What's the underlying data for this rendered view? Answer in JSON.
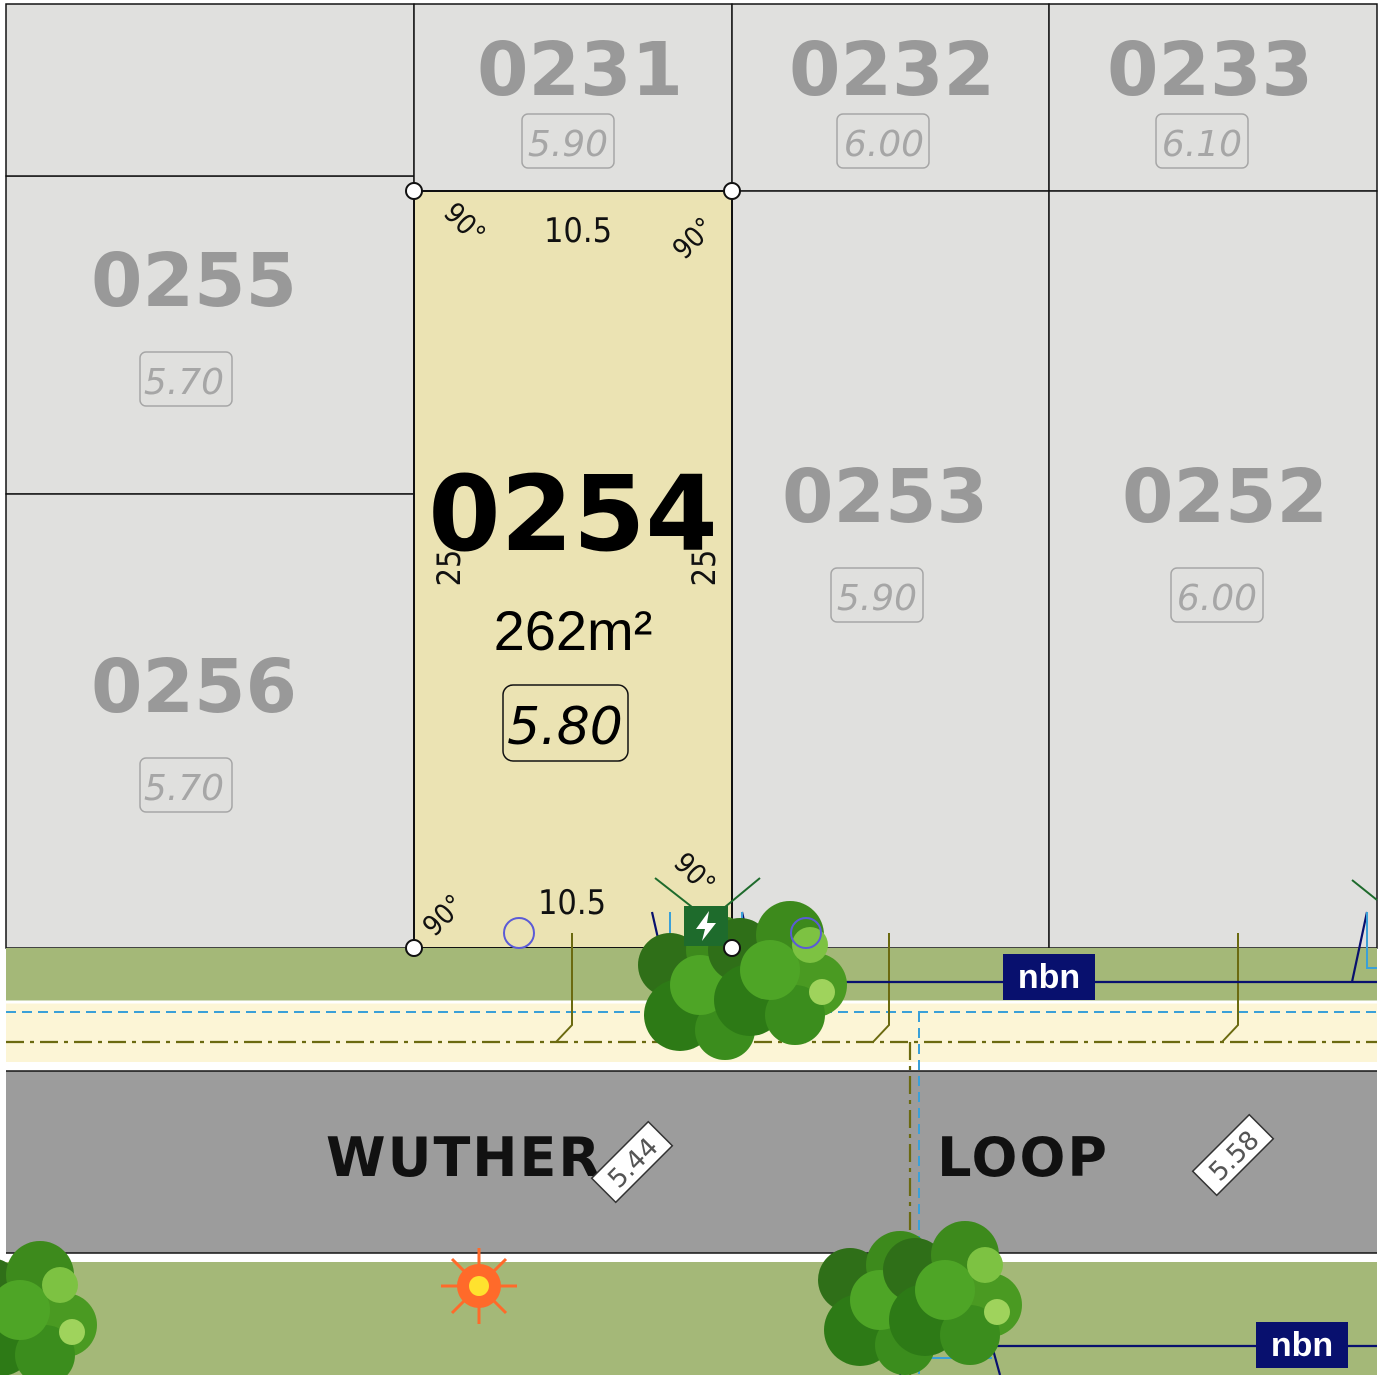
{
  "selected_lot": {
    "number": "0254",
    "area": "262m²",
    "level": "5.80",
    "frontage": "10.5",
    "depth": "25",
    "angle": "90°"
  },
  "lots": [
    {
      "number": "0231",
      "level": "5.90"
    },
    {
      "number": "0232",
      "level": "6.00"
    },
    {
      "number": "0233",
      "level": "6.10"
    },
    {
      "number": "0255",
      "level": "5.70"
    },
    {
      "number": "0256",
      "level": "5.70"
    },
    {
      "number": "0253",
      "level": "5.90"
    },
    {
      "number": "0252",
      "level": "6.00"
    }
  ],
  "street": {
    "name_part1": "WUTHER",
    "name_part2": "LOOP",
    "levels": [
      "5.44",
      "5.58"
    ]
  },
  "services": {
    "nbn_label": "nbn",
    "power_icon": "lightning-bolt-icon",
    "streetlight_icon": "sun-icon"
  },
  "colors": {
    "selected_lot_fill": "#ebe3b3",
    "lot_fill": "#e0e0de",
    "verge": "#a4b878",
    "footpath": "#fcf5d6",
    "road": "#9c9c9c",
    "nbn_badge": "#08106e",
    "tree_green": "#3d8a1c",
    "streetlight": "#ff6a2a"
  }
}
